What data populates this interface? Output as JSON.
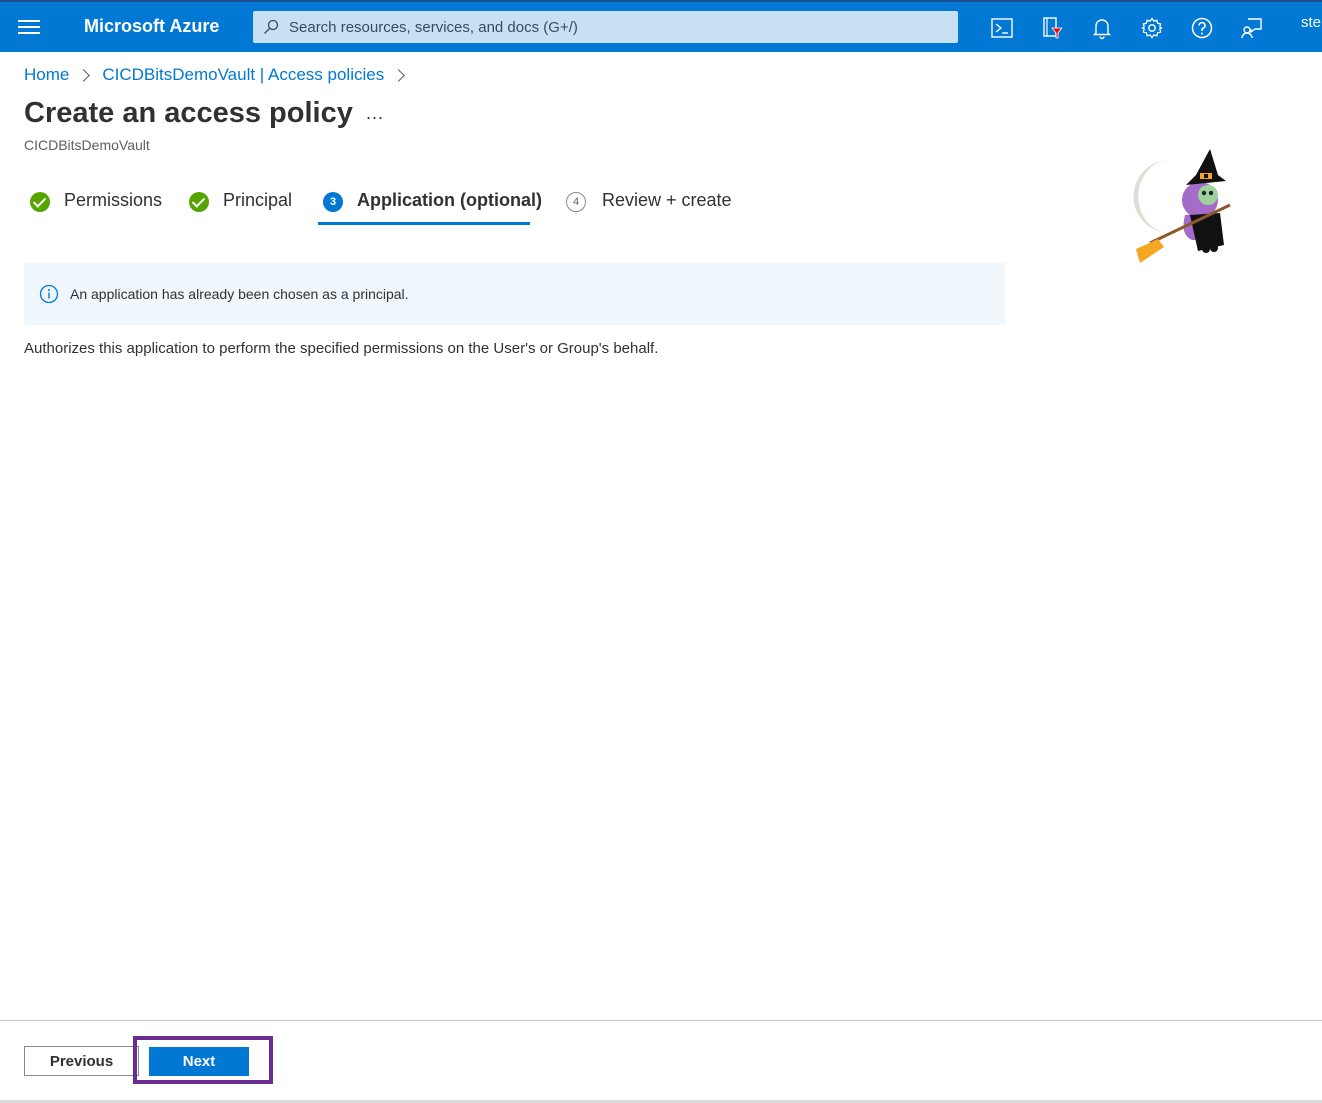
{
  "topbar": {
    "brand": "Microsoft Azure",
    "search_placeholder": "Search resources, services, and docs (G+/)",
    "user": "ste",
    "icons": [
      "menu-icon",
      "search-icon",
      "cloud-shell-icon",
      "directory-filter-icon",
      "notifications-icon",
      "settings-icon",
      "help-icon",
      "feedback-icon"
    ]
  },
  "breadcrumb": {
    "items": [
      "Home",
      "CICDBitsDemoVault | Access policies"
    ]
  },
  "page": {
    "title": "Create an access policy",
    "more": "...",
    "subtitle": "CICDBitsDemoVault"
  },
  "steps": [
    {
      "label": "Permissions",
      "status": "complete"
    },
    {
      "label": "Principal",
      "status": "complete"
    },
    {
      "label": "Application (optional)",
      "status": "active",
      "number": "3"
    },
    {
      "label": "Review + create",
      "status": "pending",
      "number": "4"
    }
  ],
  "info": {
    "text": "An application has already been chosen as a principal."
  },
  "description": "Authorizes this application to perform the specified permissions on the User's or Group's behalf.",
  "footer": {
    "previous_label": "Previous",
    "next_label": "Next"
  },
  "colors": {
    "accent": "#0078d4",
    "success": "#57a300",
    "highlight": "#6a2c91",
    "info_bg": "#eff6fc"
  }
}
